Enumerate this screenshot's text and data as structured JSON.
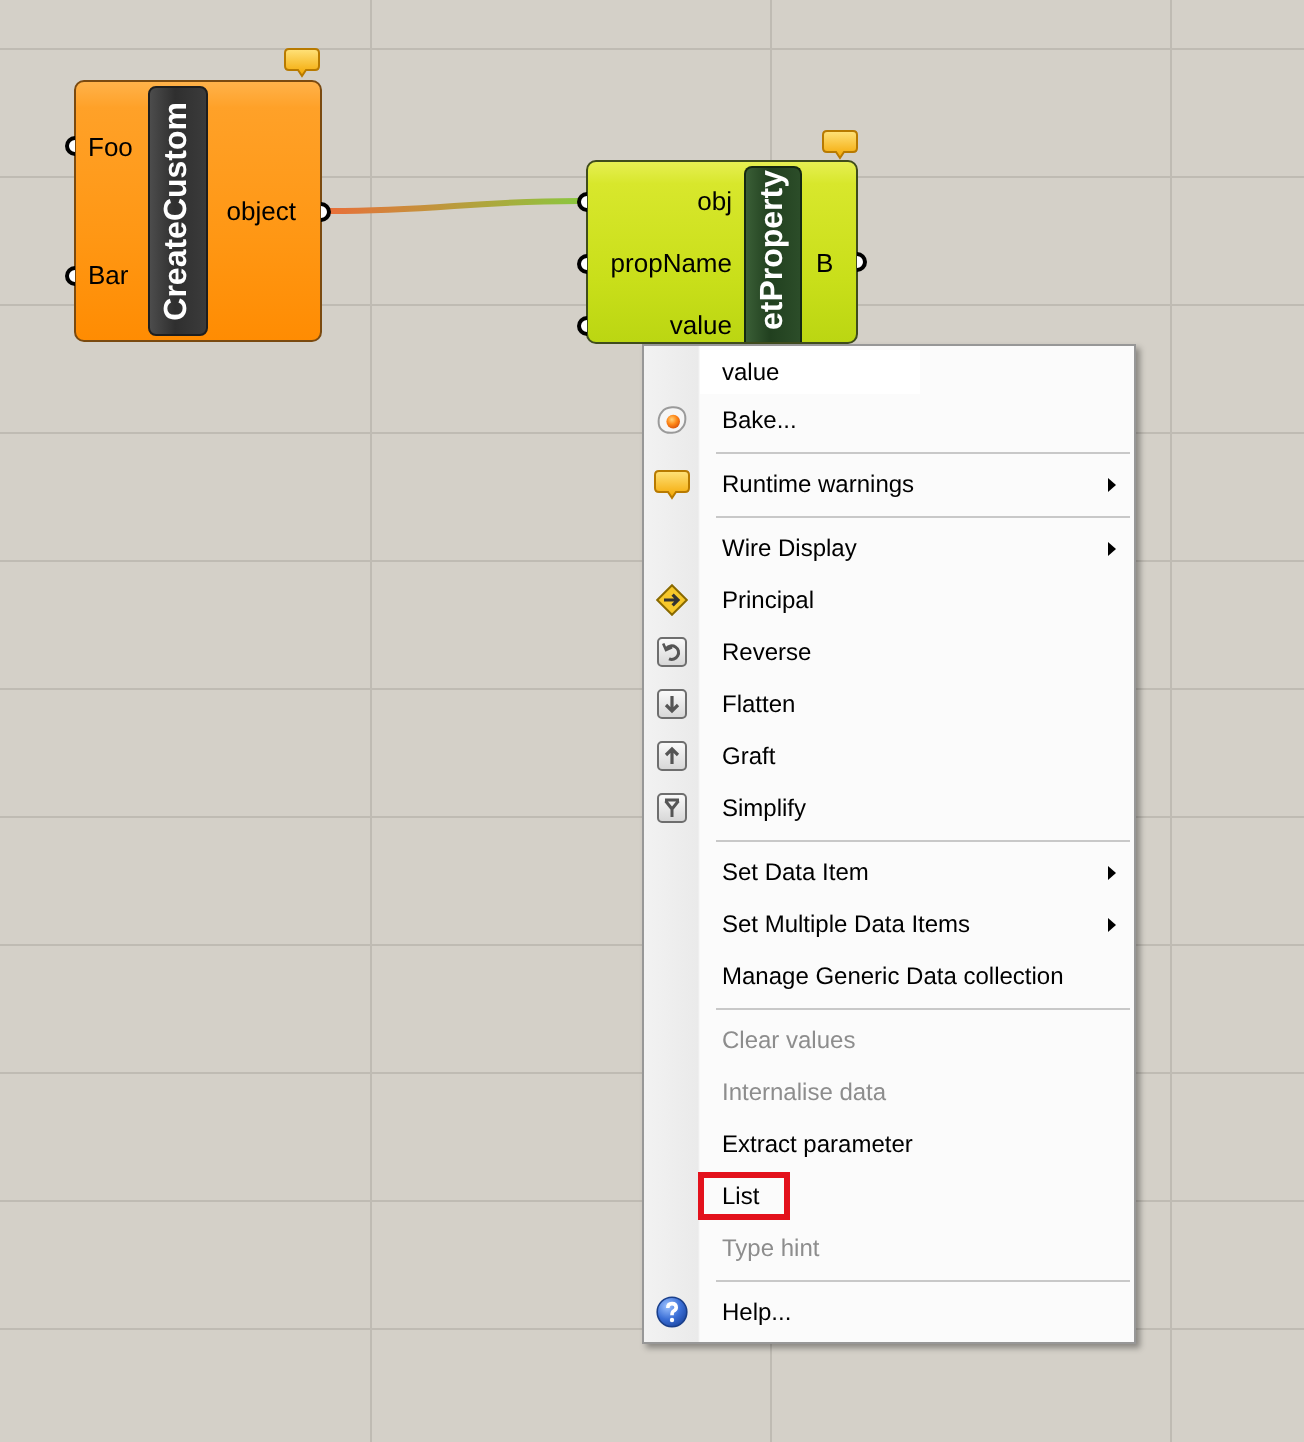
{
  "components": [
    {
      "name": "CreateCustom",
      "selected": false,
      "warning": true,
      "inputs": [
        "Foo",
        "Bar"
      ],
      "outputs": [
        "object"
      ]
    },
    {
      "name": "etProperty",
      "selected": true,
      "warning": true,
      "inputs": [
        "obj",
        "propName",
        "value"
      ],
      "outputs": [
        "B"
      ]
    }
  ],
  "menu": {
    "field": {
      "value": "value"
    },
    "groups": [
      {
        "items": [
          {
            "label": "Bake...",
            "submenu": false,
            "disabled": false,
            "outlined": false
          }
        ]
      },
      {
        "items": [
          {
            "label": "Runtime warnings",
            "submenu": true,
            "disabled": false,
            "outlined": false
          }
        ]
      },
      {
        "items": [
          {
            "label": "Wire Display",
            "submenu": true,
            "disabled": false,
            "outlined": false
          },
          {
            "label": "Principal",
            "submenu": false,
            "disabled": false,
            "outlined": false
          },
          {
            "label": "Reverse",
            "submenu": false,
            "disabled": false,
            "outlined": false
          },
          {
            "label": "Flatten",
            "submenu": false,
            "disabled": false,
            "outlined": false
          },
          {
            "label": "Graft",
            "submenu": false,
            "disabled": false,
            "outlined": false
          },
          {
            "label": "Simplify",
            "submenu": false,
            "disabled": false,
            "outlined": false
          }
        ]
      },
      {
        "items": [
          {
            "label": "Set Data Item",
            "submenu": true,
            "disabled": false,
            "outlined": false
          },
          {
            "label": "Set Multiple Data Items",
            "submenu": true,
            "disabled": false,
            "outlined": false
          },
          {
            "label": "Manage Generic Data collection",
            "submenu": false,
            "disabled": false,
            "outlined": false
          }
        ]
      },
      {
        "items": [
          {
            "label": "Clear values",
            "submenu": false,
            "disabled": true,
            "outlined": false
          },
          {
            "label": "Internalise data",
            "submenu": false,
            "disabled": true,
            "outlined": false
          },
          {
            "label": "Extract parameter",
            "submenu": false,
            "disabled": false,
            "outlined": false
          },
          {
            "label": "List",
            "submenu": false,
            "disabled": false,
            "outlined": true
          },
          {
            "label": "Type hint",
            "submenu": false,
            "disabled": true,
            "outlined": false
          }
        ]
      },
      {
        "items": [
          {
            "label": "Help...",
            "submenu": false,
            "disabled": false,
            "outlined": false
          }
        ]
      }
    ]
  }
}
